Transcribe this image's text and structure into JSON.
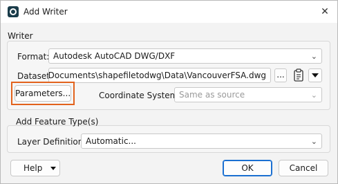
{
  "window": {
    "title": "Add Writer",
    "close_glyph": "✕"
  },
  "writer_group": {
    "label": "Writer",
    "format_label": "Format:",
    "format_value": "Autodesk AutoCAD DWG/DXF",
    "dataset_label": "Dataset:",
    "dataset_value": "izard\\Documents\\shapefiletodwg\\Data\\VancouverFSA.dwg",
    "browse_label": "...",
    "parameters_label": "Parameters...",
    "coordsys_label": "Coordinate System:",
    "coordsys_value": "Same as source"
  },
  "feature_group": {
    "label": "Add Feature Type(s)",
    "layer_def_label": "Layer Definition:",
    "layer_def_value": "Automatic..."
  },
  "footer": {
    "help_label": "Help",
    "ok_label": "OK",
    "cancel_label": "Cancel"
  },
  "icons": {
    "app": "fme-app-icon",
    "dropdown": "chevron-down-icon",
    "clipboard": "clipboard-icon",
    "menu_arrow": "triangle-down-icon"
  },
  "colors": {
    "highlight": "#e2621c",
    "default_button_border": "#1a6fd1"
  }
}
